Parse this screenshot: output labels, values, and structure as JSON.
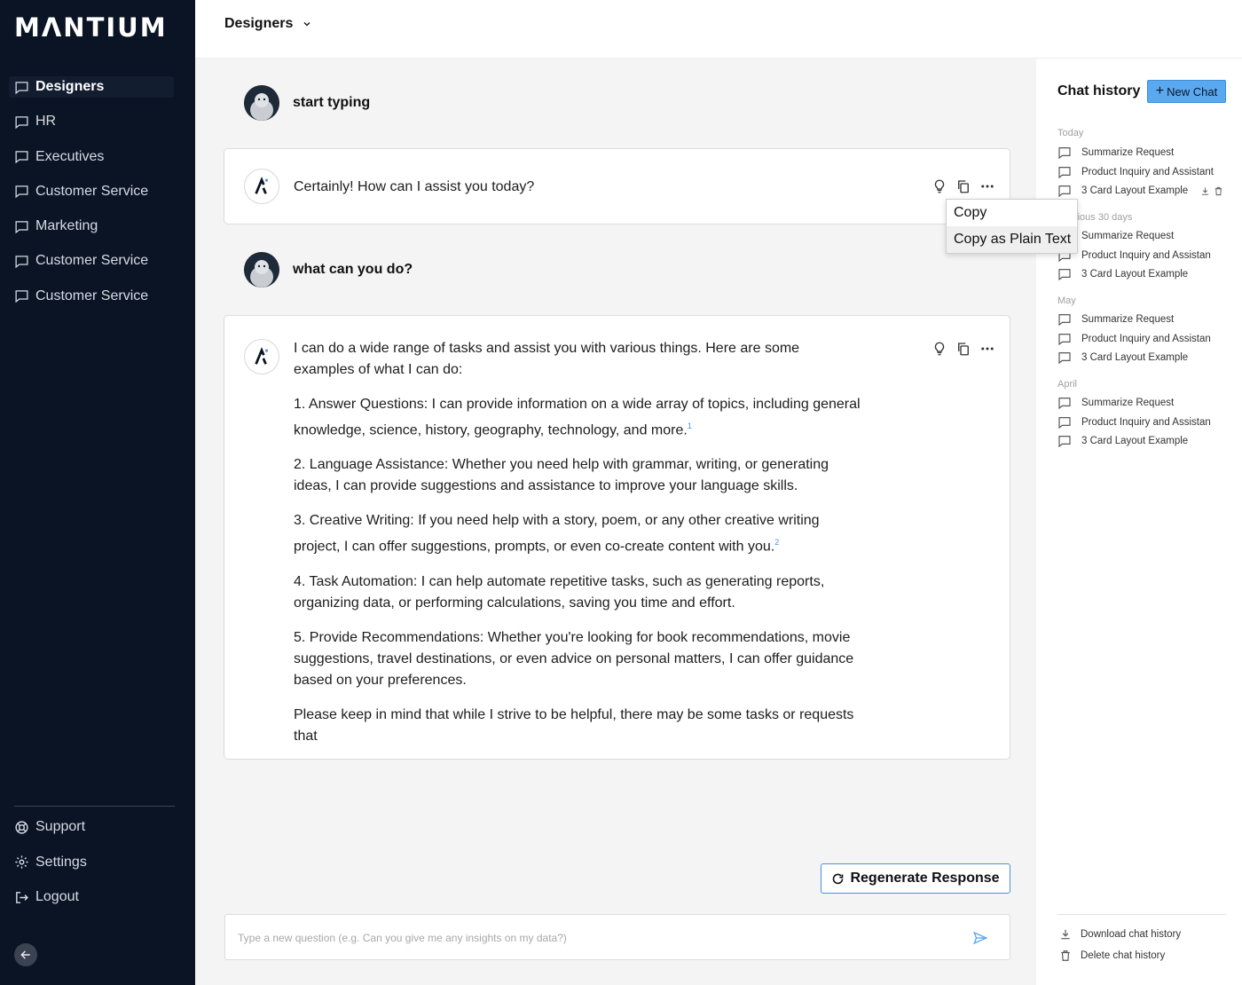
{
  "brand": {
    "logo": "MΛNTIUM"
  },
  "sidebar": {
    "items": [
      {
        "label": "Designers"
      },
      {
        "label": "HR"
      },
      {
        "label": "Executives"
      },
      {
        "label": "Customer Service"
      },
      {
        "label": "Marketing"
      },
      {
        "label": "Customer Service"
      },
      {
        "label": "Customer Service"
      }
    ],
    "bottom": [
      {
        "label": "Support",
        "icon": "lifebuoy-icon"
      },
      {
        "label": "Settings",
        "icon": "gear-icon"
      },
      {
        "label": "Logout",
        "icon": "logout-icon"
      }
    ]
  },
  "topbar": {
    "workspace": "Designers"
  },
  "chat": {
    "messages": [
      {
        "role": "user",
        "text": "start typing"
      },
      {
        "role": "assistant",
        "text": "Certainly! How can I assist you today?"
      },
      {
        "role": "user",
        "text": "what can you do?"
      },
      {
        "role": "assistant",
        "intro": "I can do a wide range of tasks and assist you with various things. Here are some examples of what I can do:",
        "p1": "1. Answer Questions: I can provide information on a wide array of topics, including general knowledge, science, history, geography, technology, and more.",
        "p1_ref": "1",
        "p2": "2. Language Assistance: Whether you need help with grammar, writing, or generating ideas, I can provide suggestions and assistance to improve your language skills.",
        "p3": "3. Creative Writing: If you need help with a story, poem, or any other creative writing project, I can offer suggestions, prompts, or even co-create content with you.",
        "p3_ref": "2",
        "p4": "4. Task Automation: I can help automate repetitive tasks, such as generating reports, organizing data, or performing calculations, saving you time and effort.",
        "p5": "5. Provide Recommendations: Whether you're looking for book recommendations, movie suggestions, travel destinations, or even advice on personal matters, I can offer guidance based on your preferences.",
        "outro": "Please keep in mind that while I strive to be helpful, there may be some tasks or requests that"
      }
    ],
    "context_menu": [
      "Copy",
      "Copy as Plain Text"
    ],
    "regenerate_label": "Regenerate Response",
    "input_placeholder": "Type a new question (e.g. Can you give me any insights on my data?)"
  },
  "history": {
    "title": "Chat history",
    "new_chat_label": "New Chat",
    "groups": [
      {
        "label": "Today",
        "items": [
          "Summarize Request",
          "Product Inquiry and Assistant",
          "3 Card Layout Example"
        ]
      },
      {
        "label": "Previous 30 days",
        "items": [
          "Summarize Request",
          "Product Inquiry and Assistan",
          "3 Card Layout Example"
        ]
      },
      {
        "label": "May",
        "items": [
          "Summarize Request",
          "Product Inquiry and Assistan",
          "3 Card Layout Example"
        ]
      },
      {
        "label": "April",
        "items": [
          "Summarize Request",
          "Product Inquiry and Assistan",
          "3 Card Layout Example"
        ]
      }
    ],
    "download_label": "Download chat history",
    "delete_label": "Delete chat history"
  },
  "colors": {
    "sidebar_bg": "#0b1425",
    "accent": "#5aa9f0",
    "border_accent": "#4a90e2"
  }
}
